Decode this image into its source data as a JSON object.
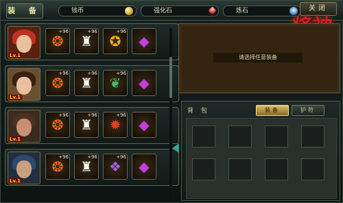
{
  "window": {
    "title": "装 备",
    "close_label": "关闭",
    "logo_text": "将神"
  },
  "currencies": [
    {
      "label": "钱币",
      "icon": "coin-icon"
    },
    {
      "label": "强化石",
      "icon": "enhance-stone-icon"
    },
    {
      "label": "炼石",
      "icon": "refine-ore-icon"
    }
  ],
  "heroes": [
    {
      "level": "Lv.1",
      "slots": [
        {
          "icon": "swirl-ring-icon",
          "plus": "+96"
        },
        {
          "icon": "white-robe-icon",
          "plus": "+96"
        },
        {
          "icon": "golden-armor-icon",
          "plus": "+96"
        },
        {
          "icon": "purple-gem-icon",
          "plus": ""
        }
      ]
    },
    {
      "level": "Lv.1",
      "slots": [
        {
          "icon": "swirl-ring-icon",
          "plus": "+96"
        },
        {
          "icon": "white-robe-icon",
          "plus": "+96"
        },
        {
          "icon": "green-scroll-icon",
          "plus": "+96"
        },
        {
          "icon": "purple-gem-icon",
          "plus": ""
        }
      ]
    },
    {
      "level": "Lv.1",
      "slots": [
        {
          "icon": "swirl-ring-icon",
          "plus": "+96"
        },
        {
          "icon": "white-robe-icon",
          "plus": "+96"
        },
        {
          "icon": "red-armor-icon",
          "plus": "+96"
        },
        {
          "icon": "purple-gem-icon",
          "plus": ""
        }
      ]
    },
    {
      "level": "Lv.1",
      "slots": [
        {
          "icon": "swirl-ring-icon",
          "plus": "+96"
        },
        {
          "icon": "white-robe-icon",
          "plus": "+96"
        },
        {
          "icon": "purple-dragon-robe-icon",
          "plus": "+96"
        },
        {
          "icon": "purple-gem-icon",
          "plus": ""
        }
      ]
    }
  ],
  "info_panel": {
    "hint": "请选择任意装备"
  },
  "bag": {
    "title": "背 包",
    "tabs": [
      {
        "label": "装备",
        "active": true
      },
      {
        "label": "护符",
        "active": false
      }
    ],
    "slot_count": 8
  },
  "colors": {
    "accent": "#d8c070",
    "logo": "#d02020",
    "panel_brown": "#33250f"
  }
}
